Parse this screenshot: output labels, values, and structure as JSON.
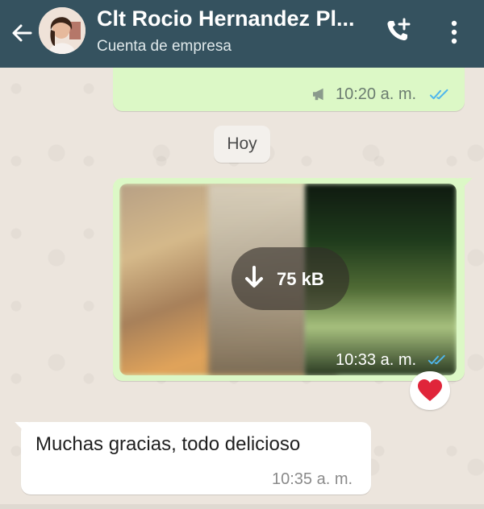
{
  "header": {
    "contact_name": "Clt Rocio Hernandez Pl...",
    "subtitle": "Cuenta de empresa",
    "icons": [
      "back-arrow-icon",
      "add-call-icon",
      "more-vert-icon"
    ]
  },
  "messages": [
    {
      "direction": "outgoing",
      "time": "10:20 a. m.",
      "status": "read",
      "icons": [
        "megaphone-icon",
        "double-check-icon"
      ]
    },
    {
      "direction": "outgoing",
      "type": "image",
      "download_size": "75 kB",
      "time": "10:33 a. m.",
      "status": "read",
      "reaction": "❤️"
    },
    {
      "direction": "incoming",
      "text": "Muchas gracias, todo delicioso",
      "time": "10:35 a. m."
    }
  ],
  "date_divider": "Hoy",
  "colors": {
    "header": "#35525f",
    "outgoing_bubble": "#dcf8c6",
    "incoming_bubble": "#ffffff",
    "read_ticks": "#4fb6ec",
    "reaction_heart": "#e0253a"
  }
}
